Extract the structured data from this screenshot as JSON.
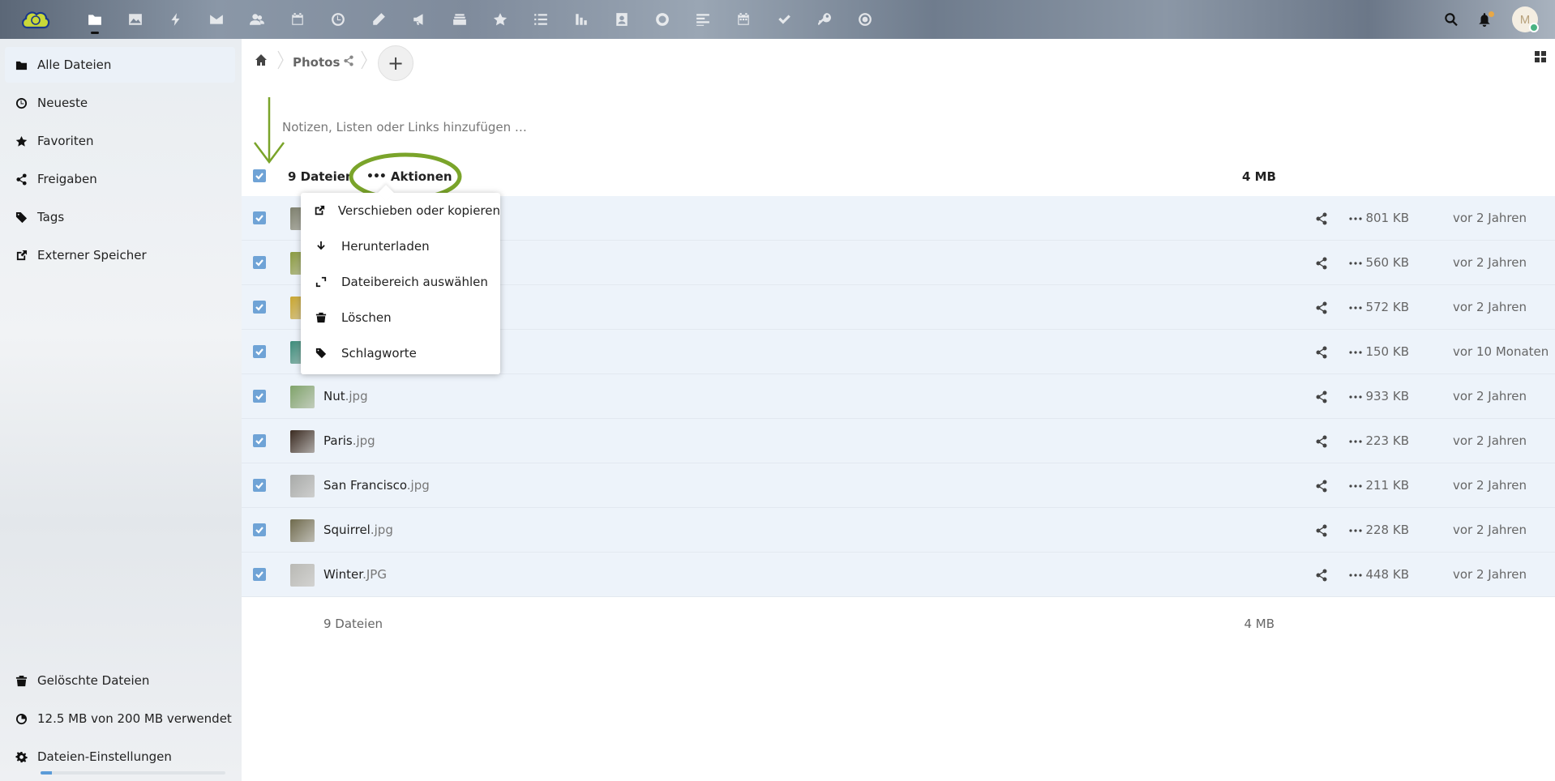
{
  "header": {
    "apps": [
      "files-icon",
      "photos-icon",
      "activity-icon",
      "mail-icon",
      "contacts-icon",
      "calendar-icon",
      "clock-icon",
      "notes-icon",
      "announcements-icon",
      "deck-icon",
      "bookmarks-icon",
      "tasks-icon",
      "analytics-icon",
      "contact-card-icon",
      "talk-icon",
      "text-icon",
      "calendar-alt-icon",
      "checkmark-icon",
      "passwords-icon",
      "circles-icon"
    ],
    "avatar_initials": "M"
  },
  "sidebar": {
    "items": [
      {
        "label": "Alle Dateien",
        "icon": "folder-icon"
      },
      {
        "label": "Neueste",
        "icon": "clock-icon"
      },
      {
        "label": "Favoriten",
        "icon": "star-icon"
      },
      {
        "label": "Freigaben",
        "icon": "share-icon"
      },
      {
        "label": "Tags",
        "icon": "tag-icon"
      },
      {
        "label": "Externer Speicher",
        "icon": "external-link-icon"
      }
    ],
    "deleted": "Gelöschte Dateien",
    "quota": "12.5 MB von 200 MB verwendet",
    "quota_fraction": 0.0625,
    "settings": "Dateien-Einstellungen"
  },
  "breadcrumb": {
    "folder": "Photos"
  },
  "notes_placeholder": "Notizen, Listen oder Links hinzufügen …",
  "list": {
    "head_count": "9 Dateien",
    "actions_label": "Aktionen",
    "head_size": "4 MB",
    "files": [
      {
        "name": "",
        "ext": "",
        "size": "801 KB",
        "date": "vor 2 Jahren",
        "thumb": "#7d7f6c"
      },
      {
        "name": "",
        "ext": "",
        "size": "560 KB",
        "date": "vor 2 Jahren",
        "thumb": "#8a9a3e"
      },
      {
        "name": "",
        "ext": "",
        "size": "572 KB",
        "date": "vor 2 Jahren",
        "thumb": "#c9a62f"
      },
      {
        "name": "",
        "ext": "",
        "size": "150 KB",
        "date": "vor 10 Monaten",
        "thumb": "#3b8c7a"
      },
      {
        "name": "Nut",
        "ext": ".jpg",
        "size": "933 KB",
        "date": "vor 2 Jahren",
        "thumb": "#7fa36a"
      },
      {
        "name": "Paris",
        "ext": ".jpg",
        "size": "223 KB",
        "date": "vor 2 Jahren",
        "thumb": "#3a2a20"
      },
      {
        "name": "San Francisco",
        "ext": ".jpg",
        "size": "211 KB",
        "date": "vor 2 Jahren",
        "thumb": "#a8aaa8"
      },
      {
        "name": "Squirrel",
        "ext": ".jpg",
        "size": "228 KB",
        "date": "vor 2 Jahren",
        "thumb": "#6f6a4c"
      },
      {
        "name": "Winter",
        "ext": ".JPG",
        "size": "448 KB",
        "date": "vor 2 Jahren",
        "thumb": "#b9b9b4"
      }
    ],
    "foot_count": "9 Dateien",
    "foot_size": "4 MB"
  },
  "menu": {
    "items": [
      {
        "label": "Verschieben oder kopieren",
        "icon": "external-link-icon"
      },
      {
        "label": "Herunterladen",
        "icon": "download-icon"
      },
      {
        "label": "Dateibereich auswählen",
        "icon": "select-range-icon"
      },
      {
        "label": "Löschen",
        "icon": "trash-icon"
      },
      {
        "label": "Schlagworte",
        "icon": "tag-icon"
      }
    ]
  },
  "colors": {
    "accent": "#6fa3d6",
    "highlight": "#7aa42a",
    "row_selected": "#edf3fa"
  }
}
